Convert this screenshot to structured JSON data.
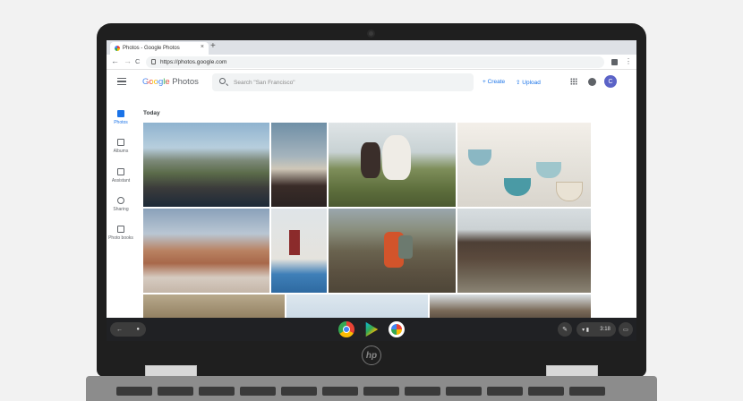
{
  "browser": {
    "tab_title": "Photos - Google Photos",
    "tab_close": "×",
    "new_tab": "+",
    "back": "←",
    "forward": "→",
    "reload": "C",
    "url": "https://photos.google.com",
    "menu": "⋮"
  },
  "app": {
    "logo_google": "Google",
    "logo_photos": "Photos",
    "search_placeholder": "Search \"San Francisco\"",
    "create_label": "+ Create",
    "upload_label": "Upload",
    "avatar_letter": "C"
  },
  "nav": {
    "items": [
      {
        "label": "Photos",
        "icon": "photos-icon",
        "active": true
      },
      {
        "label": "Albums",
        "icon": "albums-icon"
      },
      {
        "label": "Assistant",
        "icon": "assistant-icon"
      },
      {
        "label": "Sharing",
        "icon": "sharing-icon"
      },
      {
        "label": "Photo books",
        "icon": "photo-books-icon"
      }
    ]
  },
  "content": {
    "section_title": "Today",
    "photos": [
      "road-mountains",
      "church-at-dusk",
      "horses-field",
      "teacups-window",
      "hot-springs",
      "house-facade",
      "hiker-camera",
      "woman-rocks",
      "cliffs",
      "coast-sky",
      "rocky-hills"
    ]
  },
  "shelf": {
    "back": "←",
    "launcher": "●",
    "apps": [
      "chrome-icon",
      "play-store-icon",
      "google-photos-icon"
    ],
    "pen": "✎",
    "status_time": "3:18",
    "status_icons": "▾ ▮"
  },
  "laptop": {
    "brand": "hp"
  },
  "colors": {
    "accent": "#1a73e8",
    "bezel": "#1f1f1f",
    "shelf": "#202124",
    "avatar": "#5b63c7"
  }
}
